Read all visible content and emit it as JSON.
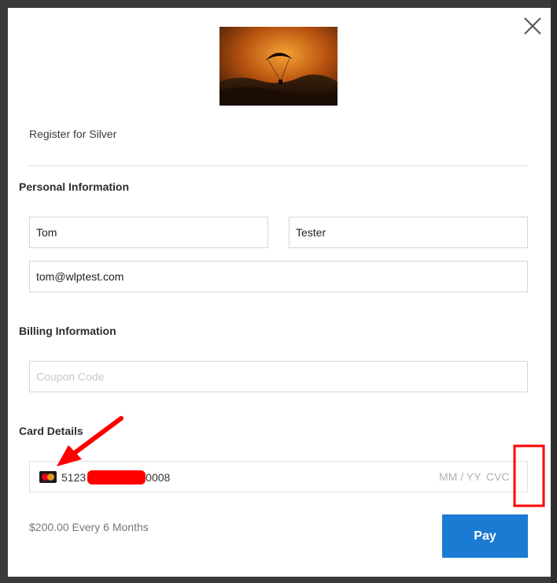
{
  "modal": {
    "title": "Register for Silver",
    "close_icon": "close-icon",
    "hero_image": "paraglider-sunset-photo"
  },
  "personal": {
    "heading": "Personal Information",
    "first_name": "Tom",
    "last_name": "Tester",
    "email": "tom@wlptest.com"
  },
  "billing": {
    "heading": "Billing Information",
    "coupon_placeholder": "Coupon Code"
  },
  "card": {
    "heading": "Card Details",
    "brand_icon": "mastercard-icon",
    "number_prefix": "5123",
    "number_suffix": "0008",
    "expiry_placeholder": "MM / YY",
    "cvc_placeholder": "CVC"
  },
  "footer": {
    "price": "$200.00 Every 6 Months",
    "pay_label": "Pay"
  },
  "colors": {
    "pay_button": "#1b7bd3",
    "annotation": "#ff0000",
    "backdrop": "#3a3a3a"
  }
}
